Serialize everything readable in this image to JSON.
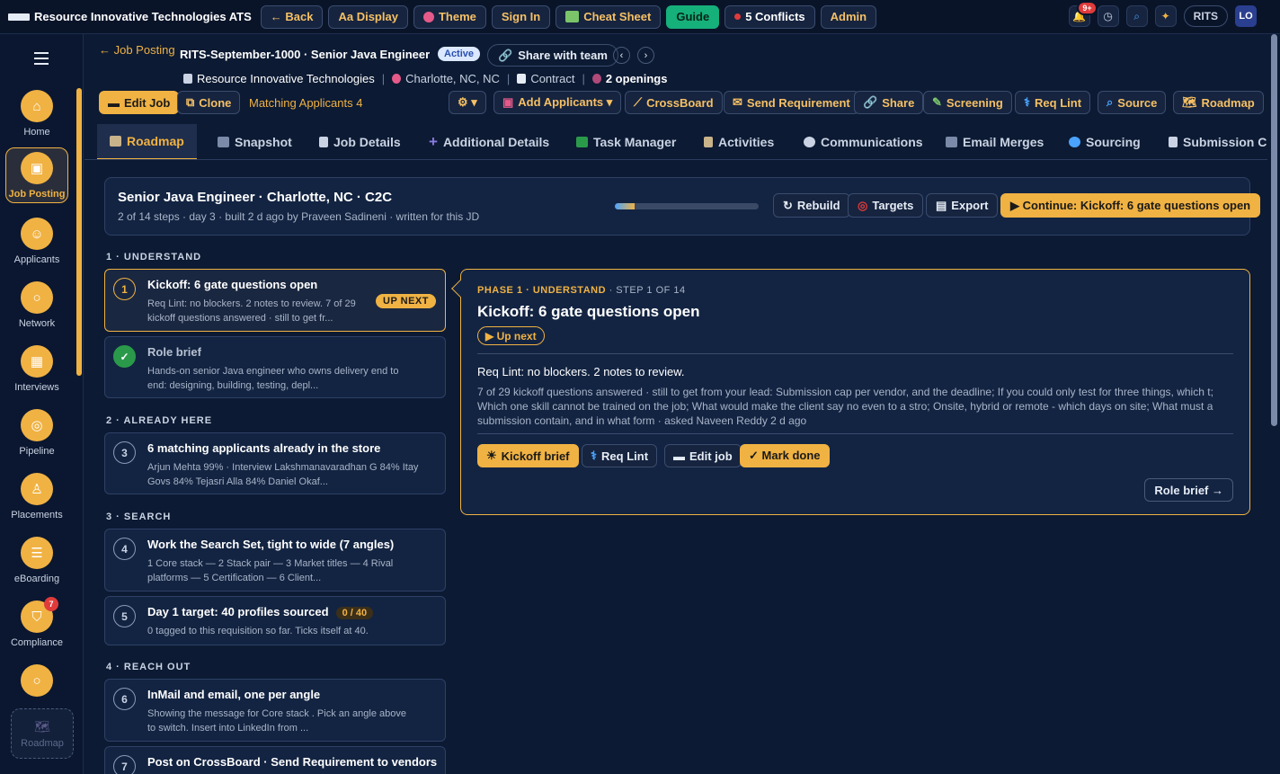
{
  "topbar": {
    "app_title": "Resource Innovative Technologies ATS",
    "back": "← Back",
    "display": "Aa Display",
    "theme": "Theme",
    "sign_in": "Sign In",
    "cheat_sheet": "Cheat Sheet",
    "guide": "Guide",
    "conflicts": "5 Conflicts",
    "admin": "Admin",
    "notif_count": "9+",
    "org": "RITS",
    "user_initials": "LO"
  },
  "sidebar": {
    "items": [
      {
        "label": "Home",
        "icon": "home-icon"
      },
      {
        "label": "Job Posting",
        "icon": "briefcase-icon"
      },
      {
        "label": "Applicants",
        "icon": "users-icon"
      },
      {
        "label": "Network",
        "icon": "circle-icon"
      },
      {
        "label": "Interviews",
        "icon": "calendar-icon"
      },
      {
        "label": "Pipeline",
        "icon": "target-icon"
      },
      {
        "label": "Placements",
        "icon": "award-icon"
      },
      {
        "label": "eBoarding",
        "icon": "clipboard-icon"
      },
      {
        "label": "Compliance",
        "icon": "shield-icon",
        "badge": "7"
      },
      {
        "label": "",
        "icon": "circle-icon"
      }
    ],
    "roadmap": "Roadmap"
  },
  "header": {
    "back_link": "← Job Posting",
    "title": "RITS-September-1000 · Senior Java Engineer",
    "status": "Active",
    "share_team": "Share with team",
    "prev": "‹",
    "next": "›",
    "company": "Resource Innovative Technologies",
    "location": "Charlotte, NC, NC",
    "type": "Contract",
    "openings": "2 openings"
  },
  "actions": {
    "edit": "Edit Job",
    "clone": "Clone",
    "matching": "Matching Applicants 4",
    "settings": "⚙ ▾",
    "add_applicants": "Add Applicants ▾",
    "crossboard": "CrossBoard",
    "send_req": "Send Requirement",
    "share": "Share",
    "screening": "Screening",
    "req_lint": "Req Lint",
    "source": "Source",
    "roadmap": "Roadmap"
  },
  "tabs": [
    "Roadmap",
    "Snapshot",
    "Job Details",
    "Additional Details",
    "Task Manager",
    "Activities",
    "Communications",
    "Email Merges",
    "Sourcing",
    "Submission Che"
  ],
  "summary": {
    "title": "Senior Java Engineer · Charlotte, NC · C2C",
    "subtitle": "2 of 14 steps · day 3 · built 2 d ago by Praveen Sadineni · written for this JD",
    "progress": 0.14,
    "rebuild": "Rebuild",
    "targets": "Targets",
    "export": "Export",
    "continue": "▶ Continue: Kickoff: 6 gate questions open"
  },
  "sections": {
    "s1": "1 · UNDERSTAND",
    "s2": "2 · ALREADY HERE",
    "s3": "3 · SEARCH",
    "s4": "4 · REACH OUT"
  },
  "steps": [
    {
      "num": "1",
      "title": "Kickoff: 6 gate questions open",
      "desc": "Req Lint: no blockers. 2 notes to review. 7 of 29 kickoff questions answered · still to get fr...",
      "badge": "UP NEXT"
    },
    {
      "num": "✓",
      "title": "Role brief",
      "desc": "Hands-on senior Java engineer who owns delivery end to end: designing, building, testing, depl..."
    },
    {
      "num": "3",
      "title": "6 matching applicants already in the store",
      "desc": "Arjun Mehta 99% · Interview Lakshmanavaradhan G 84% Itay Govs 84% Tejasri Alla 84% Daniel Okaf..."
    },
    {
      "num": "4",
      "title": "Work the Search Set, tight to wide (7 angles)",
      "desc": "1 Core stack — 2 Stack pair — 3 Market titles — 4 Rival platforms — 5 Certification — 6 Client..."
    },
    {
      "num": "5",
      "title": "Day 1 target: 40 profiles sourced",
      "count": "0 / 40",
      "desc": "0 tagged to this requisition so far. Ticks itself at 40."
    },
    {
      "num": "6",
      "title": "InMail and email, one per angle",
      "desc": "Showing the message for Core stack . Pick an angle above to switch. Insert into LinkedIn from ..."
    },
    {
      "num": "7",
      "title": "Post on CrossBoard · Send Requirement to vendors",
      "desc": ""
    }
  ],
  "detail": {
    "phase": "PHASE 1 · UNDERSTAND",
    "step_of": " · STEP 1 OF 14",
    "title": "Kickoff: 6 gate questions open",
    "up_next": "▶ Up next",
    "headline": "Req Lint: no blockers. 2 notes to review.",
    "body": "7 of 29 kickoff questions answered · still to get from your lead: Submission cap per vendor, and the deadline; If you could only test for three things, which t; Which one skill cannot be trained on the job; What would make the client say no even to a stro; Onsite, hybrid or remote - which days on site; What must a submission contain, and in what form · asked Naveen Reddy 2 d ago",
    "kickoff_brief": "Kickoff brief",
    "req_lint": "Req Lint",
    "edit_job": "Edit job",
    "mark_done": "✓ Mark done",
    "role_brief": "Role brief →"
  }
}
